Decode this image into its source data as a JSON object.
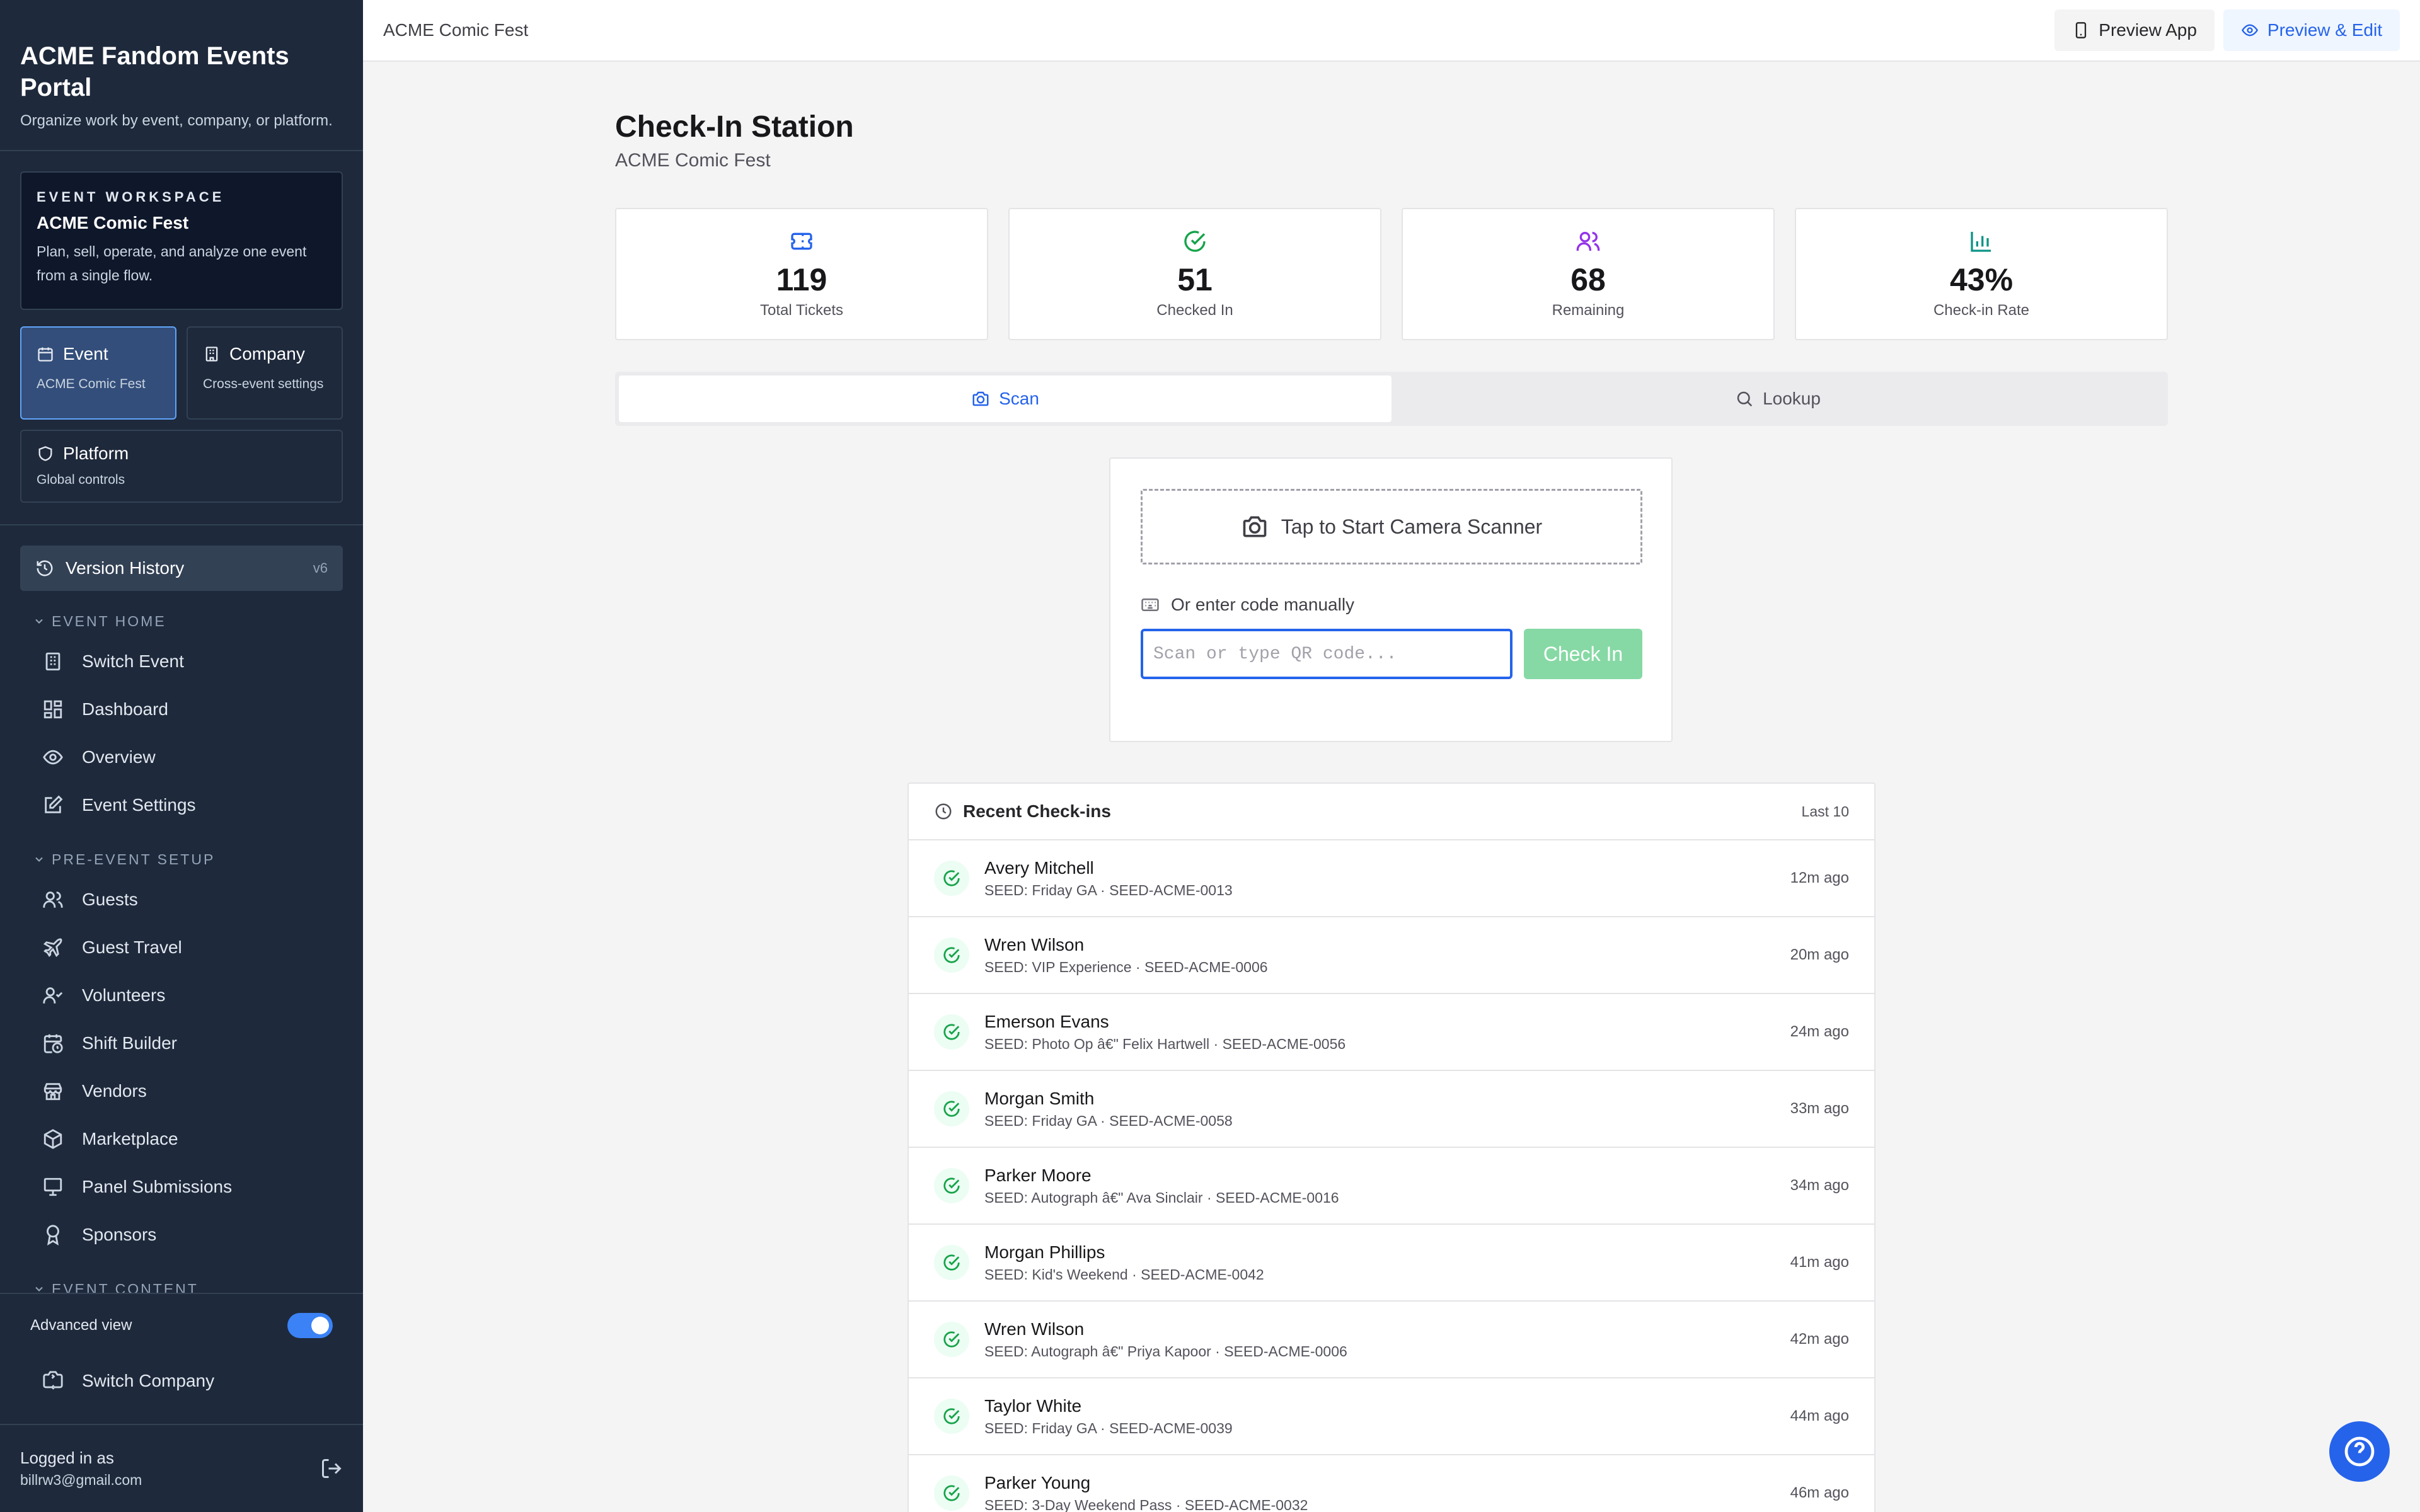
{
  "brand": {
    "title": "ACME Fandom Events Portal",
    "subtitle": "Organize work by event, company, or platform."
  },
  "workspace": {
    "kicker": "EVENT WORKSPACE",
    "name": "ACME Comic Fest",
    "description": "Plan, sell, operate, and analyze one event from a single flow."
  },
  "scopes": {
    "event": {
      "title": "Event",
      "sub": "ACME Comic Fest"
    },
    "company": {
      "title": "Company",
      "sub": "Cross-event settings"
    },
    "platform": {
      "title": "Platform",
      "sub": "Global controls"
    }
  },
  "version": {
    "label": "Version History",
    "tag": "v6"
  },
  "nav": {
    "sections": [
      {
        "title": "EVENT HOME",
        "items": [
          "Switch Event",
          "Dashboard",
          "Overview",
          "Event Settings"
        ]
      },
      {
        "title": "PRE-EVENT SETUP",
        "items": [
          "Guests",
          "Guest Travel",
          "Volunteers",
          "Shift Builder",
          "Vendors",
          "Marketplace",
          "Panel Submissions",
          "Sponsors"
        ]
      },
      {
        "title": "EVENT CONTENT",
        "items": []
      }
    ]
  },
  "sidebar_bottom": {
    "advanced_label": "Advanced view",
    "advanced_on": true,
    "switch_company": "Switch Company",
    "logged_label": "Logged in as",
    "email": "billrw3@gmail.com"
  },
  "topbar": {
    "title": "ACME Comic Fest",
    "preview_app": "Preview App",
    "preview_edit": "Preview & Edit"
  },
  "page": {
    "title": "Check-In Station",
    "subtitle": "ACME Comic Fest"
  },
  "stats": [
    {
      "value": "119",
      "label": "Total Tickets",
      "icon": "ticket-icon",
      "color": "#2563eb"
    },
    {
      "value": "51",
      "label": "Checked In",
      "icon": "check-circle-icon",
      "color": "#16a34a"
    },
    {
      "value": "68",
      "label": "Remaining",
      "icon": "users-icon",
      "color": "#9333ea"
    },
    {
      "value": "43%",
      "label": "Check-in Rate",
      "icon": "bar-chart-icon",
      "color": "#0d9488"
    }
  ],
  "tabs": {
    "scan": "Scan",
    "lookup": "Lookup",
    "active": "scan"
  },
  "scanner": {
    "start_label": "Tap to Start Camera Scanner",
    "manual_label": "Or enter code manually",
    "input_value": "",
    "input_placeholder": "Scan or type QR code...",
    "checkin_label": "Check In"
  },
  "recent": {
    "title": "Recent Check-ins",
    "badge": "Last 10",
    "rows": [
      {
        "name": "Avery Mitchell",
        "meta": "SEED: Friday GA · SEED-ACME-0013",
        "time": "12m ago"
      },
      {
        "name": "Wren Wilson",
        "meta": "SEED: VIP Experience · SEED-ACME-0006",
        "time": "20m ago"
      },
      {
        "name": "Emerson Evans",
        "meta": "SEED: Photo Op â€\" Felix Hartwell · SEED-ACME-0056",
        "time": "24m ago"
      },
      {
        "name": "Morgan Smith",
        "meta": "SEED: Friday GA · SEED-ACME-0058",
        "time": "33m ago"
      },
      {
        "name": "Parker Moore",
        "meta": "SEED: Autograph â€\" Ava Sinclair · SEED-ACME-0016",
        "time": "34m ago"
      },
      {
        "name": "Morgan Phillips",
        "meta": "SEED: Kid's Weekend · SEED-ACME-0042",
        "time": "41m ago"
      },
      {
        "name": "Wren Wilson",
        "meta": "SEED: Autograph â€\" Priya Kapoor · SEED-ACME-0006",
        "time": "42m ago"
      },
      {
        "name": "Taylor White",
        "meta": "SEED: Friday GA · SEED-ACME-0039",
        "time": "44m ago"
      },
      {
        "name": "Parker Young",
        "meta": "SEED: 3-Day Weekend Pass · SEED-ACME-0032",
        "time": "46m ago"
      }
    ]
  },
  "colors": {
    "sidebar_bg": "#1e293b",
    "accent": "#2563eb",
    "success": "#16a34a",
    "checkin_button": "#86d9a4"
  }
}
